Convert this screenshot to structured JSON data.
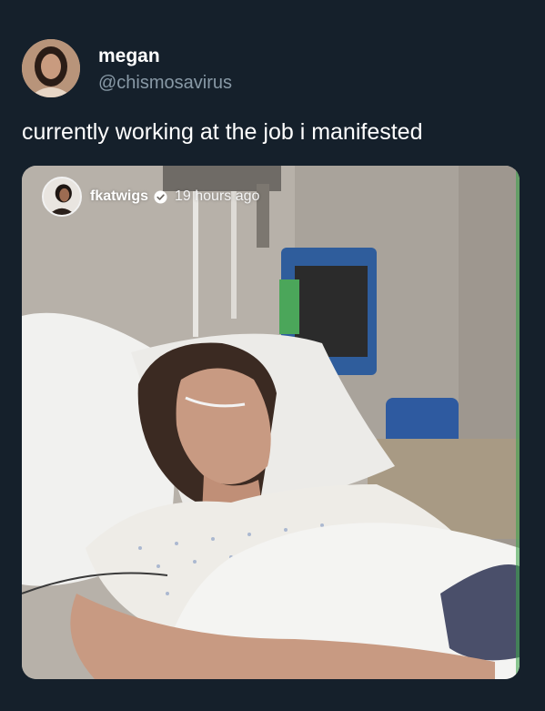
{
  "tweet": {
    "display_name": "megan",
    "handle": "@chismosavirus",
    "text": "currently working at the job i manifested",
    "avatar_icon": "profile-photo"
  },
  "media": {
    "story": {
      "username": "fkatwigs",
      "verified_icon": "verified-badge-icon",
      "timestamp": "19 hours ago"
    }
  },
  "colors": {
    "background": "#15202b",
    "primary_text": "#ffffff",
    "secondary_text": "#8899a6"
  }
}
